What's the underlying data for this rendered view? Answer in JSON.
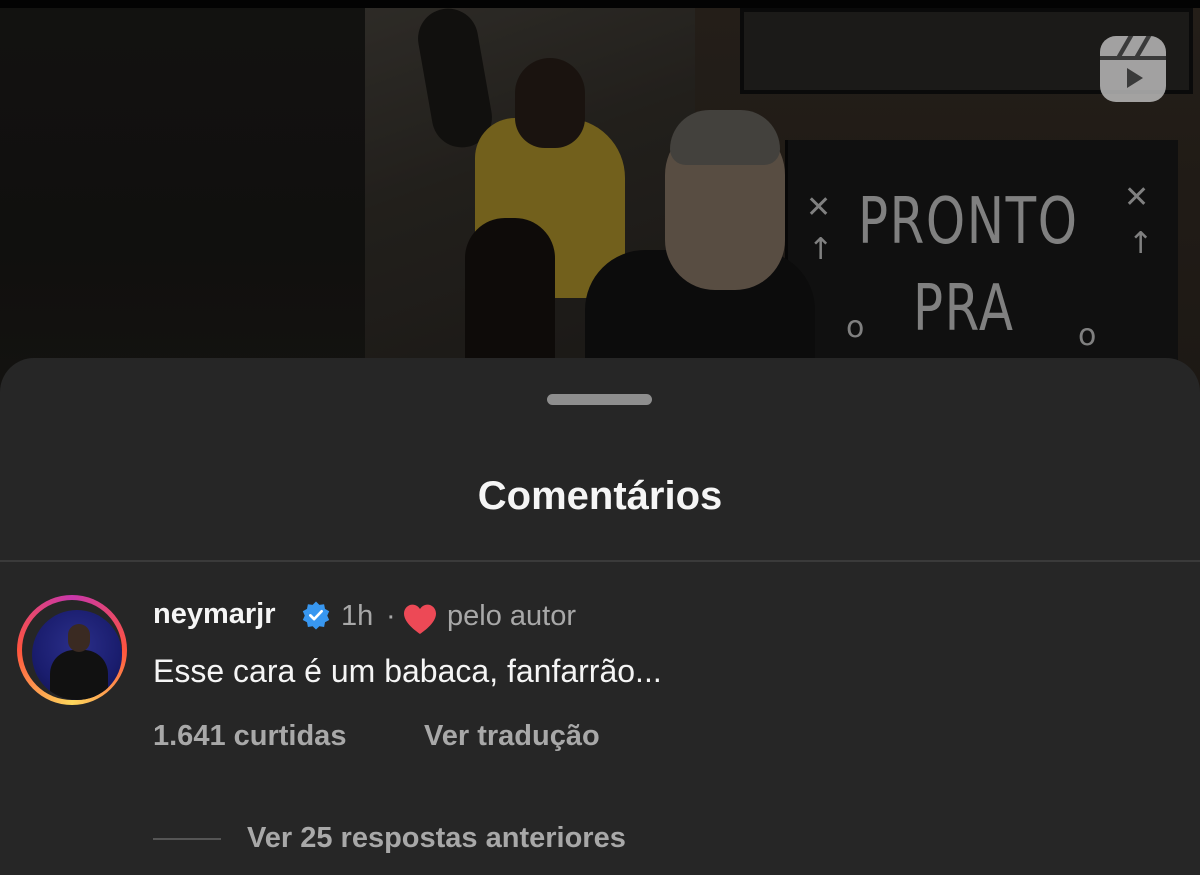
{
  "video": {
    "board_line1": "PRONTO",
    "board_line2": "PRA",
    "reels_icon": "reels-icon"
  },
  "sheet": {
    "title": "Comentários"
  },
  "comment": {
    "username": "neymarjr",
    "verified_icon": "verified-badge-icon",
    "time": "1h",
    "separator": "·",
    "liked_icon": "heart-icon",
    "liked_by_author": "pelo autor",
    "text": "Esse cara é um babaca, fanfarrão...",
    "likes": "1.641 curtidas",
    "translate": "Ver tradução",
    "view_replies": "Ver 25 respostas anteriores"
  },
  "colors": {
    "sheet_bg": "#262626",
    "primary_text": "#f5f5f5",
    "secondary_text": "#a8a8a8",
    "verified_blue": "#3897f0",
    "heart_red": "#ed4956"
  }
}
